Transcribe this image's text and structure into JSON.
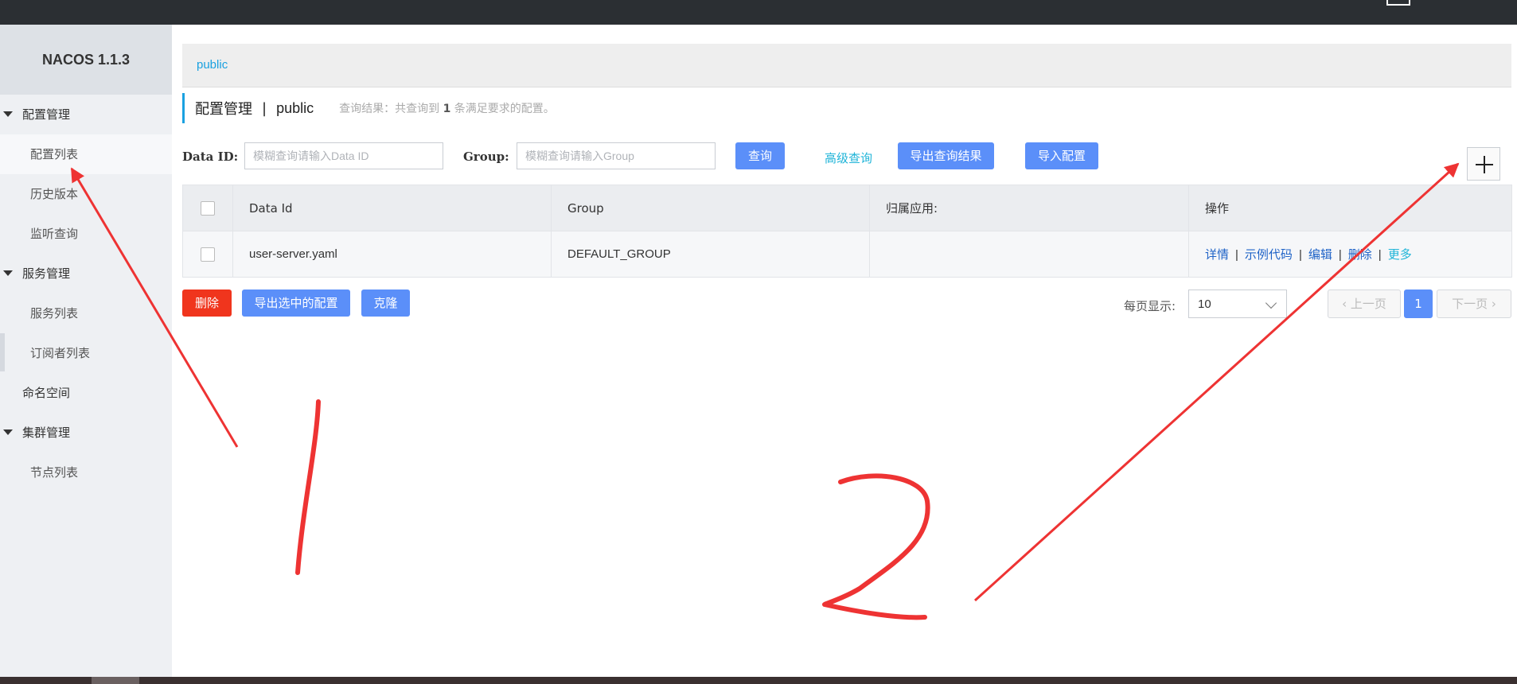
{
  "app": {
    "version_label": "NACOS 1.1.3"
  },
  "sidebar": {
    "groups": [
      {
        "label": "配置管理",
        "items": [
          {
            "label": "配置列表",
            "active": true
          },
          {
            "label": "历史版本"
          },
          {
            "label": "监听查询"
          }
        ]
      },
      {
        "label": "服务管理",
        "items": [
          {
            "label": "服务列表"
          },
          {
            "label": "订阅者列表"
          }
        ]
      },
      {
        "label": "命名空间"
      },
      {
        "label": "集群管理",
        "items": [
          {
            "label": "节点列表"
          }
        ]
      }
    ]
  },
  "namespace_bar": {
    "current": "public"
  },
  "header": {
    "title": "配置管理",
    "separator": "|",
    "namespace": "public",
    "result_prefix": "查询结果：共查询到",
    "result_count": "1",
    "result_suffix": "条满足要求的配置。"
  },
  "search": {
    "dataid_label": "Data ID:",
    "dataid_placeholder": "模糊查询请输入Data ID",
    "group_label": "Group:",
    "group_placeholder": "模糊查询请输入Group",
    "query_button": "查询",
    "advanced_link": "高级查询",
    "export_results_button": "导出查询结果",
    "import_button": "导入配置"
  },
  "table": {
    "columns": [
      "Data Id",
      "Group",
      "归属应用:",
      "操作"
    ],
    "rows": [
      {
        "data_id": "user-server.yaml",
        "group": "DEFAULT_GROUP",
        "app": "",
        "actions": [
          "详情",
          "示例代码",
          "编辑",
          "删除",
          "更多"
        ]
      }
    ]
  },
  "bulk_actions": {
    "delete": "删除",
    "export_selected": "导出选中的配置",
    "clone": "克隆"
  },
  "pagination": {
    "per_page_label": "每页显示:",
    "per_page_value": "10",
    "prev": "上一页",
    "current": "1",
    "next": "下一页"
  },
  "annotations": {
    "mark_1": "1",
    "mark_2": "2"
  },
  "colors": {
    "accent": "#5b8ff9",
    "danger": "#f0351d",
    "link": "#1fb4d8",
    "annotation": "#ee3333"
  }
}
